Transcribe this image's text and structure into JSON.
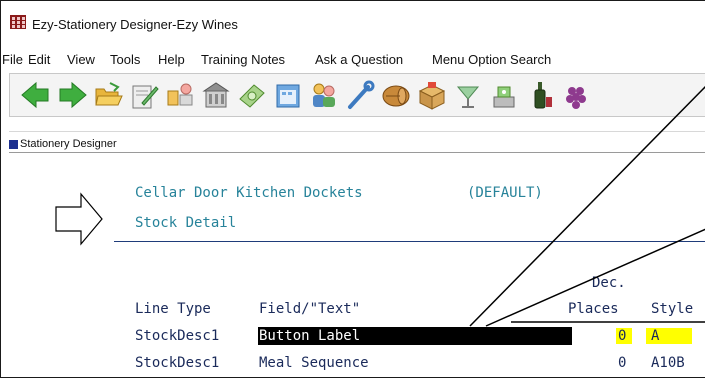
{
  "window": {
    "title": "Ezy-Stationery Designer-Ezy Wines"
  },
  "menu": {
    "items": [
      "File",
      "Edit",
      "View",
      "Tools",
      "Help",
      "Training Notes",
      "Ask a Question",
      "Menu Option Search"
    ]
  },
  "toolbar": {
    "icons": [
      "arrow-left-icon",
      "arrow-right-icon",
      "folder-open-icon",
      "edit-document-icon",
      "handshake-icon",
      "building-icon",
      "money-icon",
      "calendar-icon",
      "people-icon",
      "wrench-icon",
      "barrel-icon",
      "box-icon",
      "cocktail-icon",
      "scale-icon",
      "wine-bottle-icon",
      "grapes-icon"
    ]
  },
  "subwindow": {
    "title": "Stationery Designer"
  },
  "document": {
    "name": "Cellar Door Kitchen Dockets",
    "tag": "(DEFAULT)",
    "section": "Stock Detail"
  },
  "table": {
    "headers": {
      "line_type": "Line Type",
      "field": "Field/\"Text\"",
      "dec_line1": "Dec.",
      "dec_line2": "Places",
      "style": "Style"
    },
    "rows": [
      {
        "line_type": "StockDesc1",
        "field": "Button Label",
        "dec": "0",
        "style": "A"
      },
      {
        "line_type": "StockDesc1",
        "field": "Meal Sequence",
        "dec": "0",
        "style": "A10B"
      }
    ]
  },
  "colors": {
    "teal_text": "#27839a",
    "dark_text": "#1a2a5a",
    "highlight": "#ffff00",
    "selection": "#000000"
  }
}
